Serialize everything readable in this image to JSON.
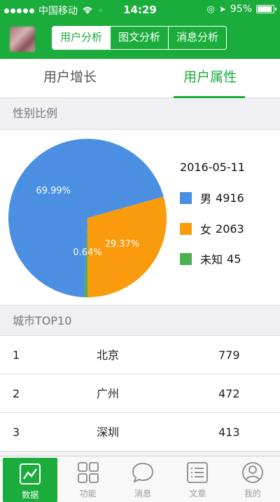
{
  "status_bar": {
    "carrier": "中国移动",
    "time": "14:29",
    "battery": "95%"
  },
  "header": {
    "segments": [
      "用户分析",
      "图文分析",
      "消息分析"
    ],
    "active_segment": 0
  },
  "tabs": [
    {
      "label": "用户增长",
      "active": false
    },
    {
      "label": "用户属性",
      "active": true
    }
  ],
  "gender_section": {
    "title": "性别比例"
  },
  "chart_data": {
    "type": "pie",
    "title": "2016-05-11",
    "slices": [
      {
        "label": "男",
        "value": 4916,
        "percent_label": "69.99%",
        "color": "#4a8fe2"
      },
      {
        "label": "女",
        "value": 2063,
        "percent_label": "29.37%",
        "color": "#f99b0c"
      },
      {
        "label": "未知",
        "value": 45,
        "percent_label": "0.64%",
        "color": "#4caf50"
      }
    ]
  },
  "city_section": {
    "title": "城市TOP10",
    "rows": [
      {
        "rank": "1",
        "city": "北京",
        "value": "779"
      },
      {
        "rank": "2",
        "city": "广州",
        "value": "472"
      },
      {
        "rank": "3",
        "city": "深圳",
        "value": "413"
      }
    ]
  },
  "tabbar": {
    "items": [
      {
        "label": "数据",
        "icon": "chart-line-icon",
        "active": true
      },
      {
        "label": "功能",
        "icon": "grid-icon",
        "active": false
      },
      {
        "label": "消息",
        "icon": "chat-bubble-icon",
        "active": false
      },
      {
        "label": "文章",
        "icon": "article-list-icon",
        "active": false
      },
      {
        "label": "我的",
        "icon": "user-icon",
        "active": false
      }
    ]
  },
  "colors": {
    "brand_green": "#1aad3b"
  }
}
